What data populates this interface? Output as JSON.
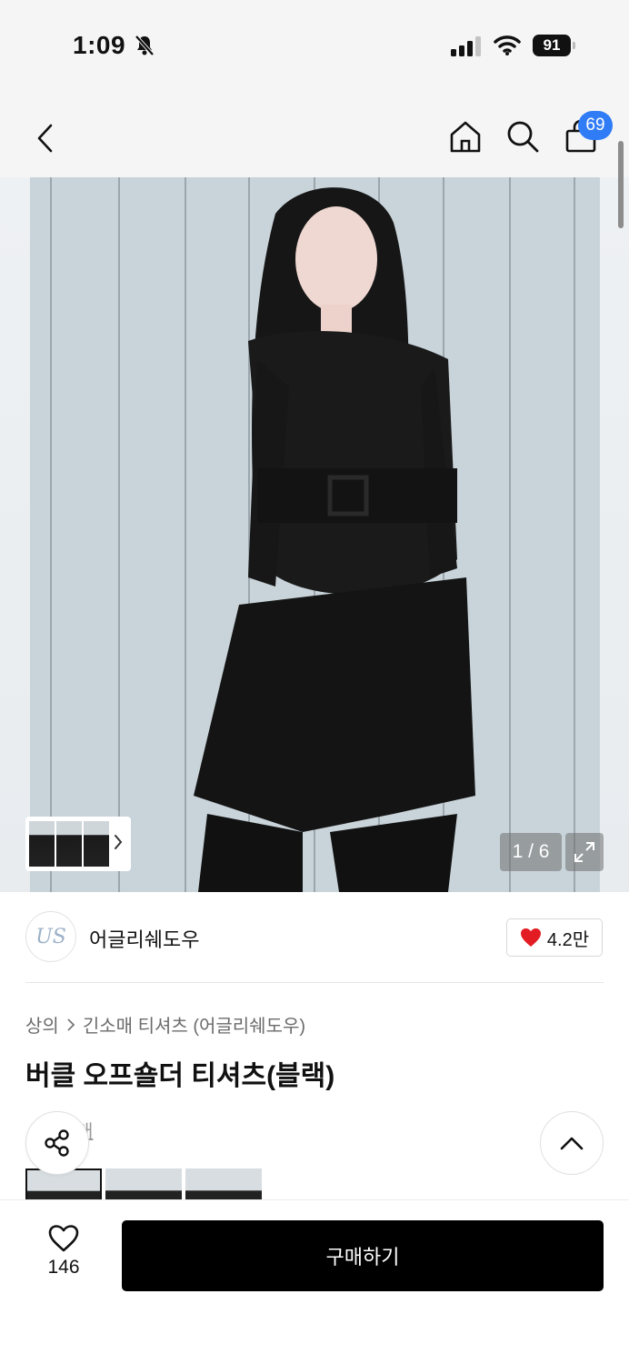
{
  "status_bar": {
    "time": "1:09",
    "battery": "91",
    "icons": [
      "bell-slash-icon",
      "cellular-signal-icon",
      "wifi-icon",
      "battery-icon"
    ]
  },
  "nav": {
    "back_icon": "chevron-left-icon",
    "home_icon": "home-icon",
    "search_icon": "search-icon",
    "cart_icon": "shopping-bag-icon",
    "cart_count": "69"
  },
  "gallery": {
    "counter": "1 / 6",
    "current_index": 1,
    "total": 6,
    "thumb_strip_icon": "chevron-right-icon",
    "expand_icon": "expand-icon"
  },
  "brand": {
    "name": "어글리쉐도우",
    "logo_text": "US",
    "like_count": "4.2만",
    "like_color": "#e31b23"
  },
  "product": {
    "breadcrumb": [
      "상의",
      "긴소매 티셔츠 (어글리쉐도우)"
    ],
    "title": "버클 오프숄더 티셔츠(블랙)",
    "sub_link": "매"
  },
  "floating": {
    "share_icon": "share-icon",
    "scroll_top_icon": "chevron-up-icon"
  },
  "bottom_bar": {
    "wish_count": "146",
    "buy_label": "구매하기"
  },
  "colors": {
    "accent_blue": "#2f7cf6",
    "heart_red": "#e31b23",
    "buy_button": "#000000"
  }
}
